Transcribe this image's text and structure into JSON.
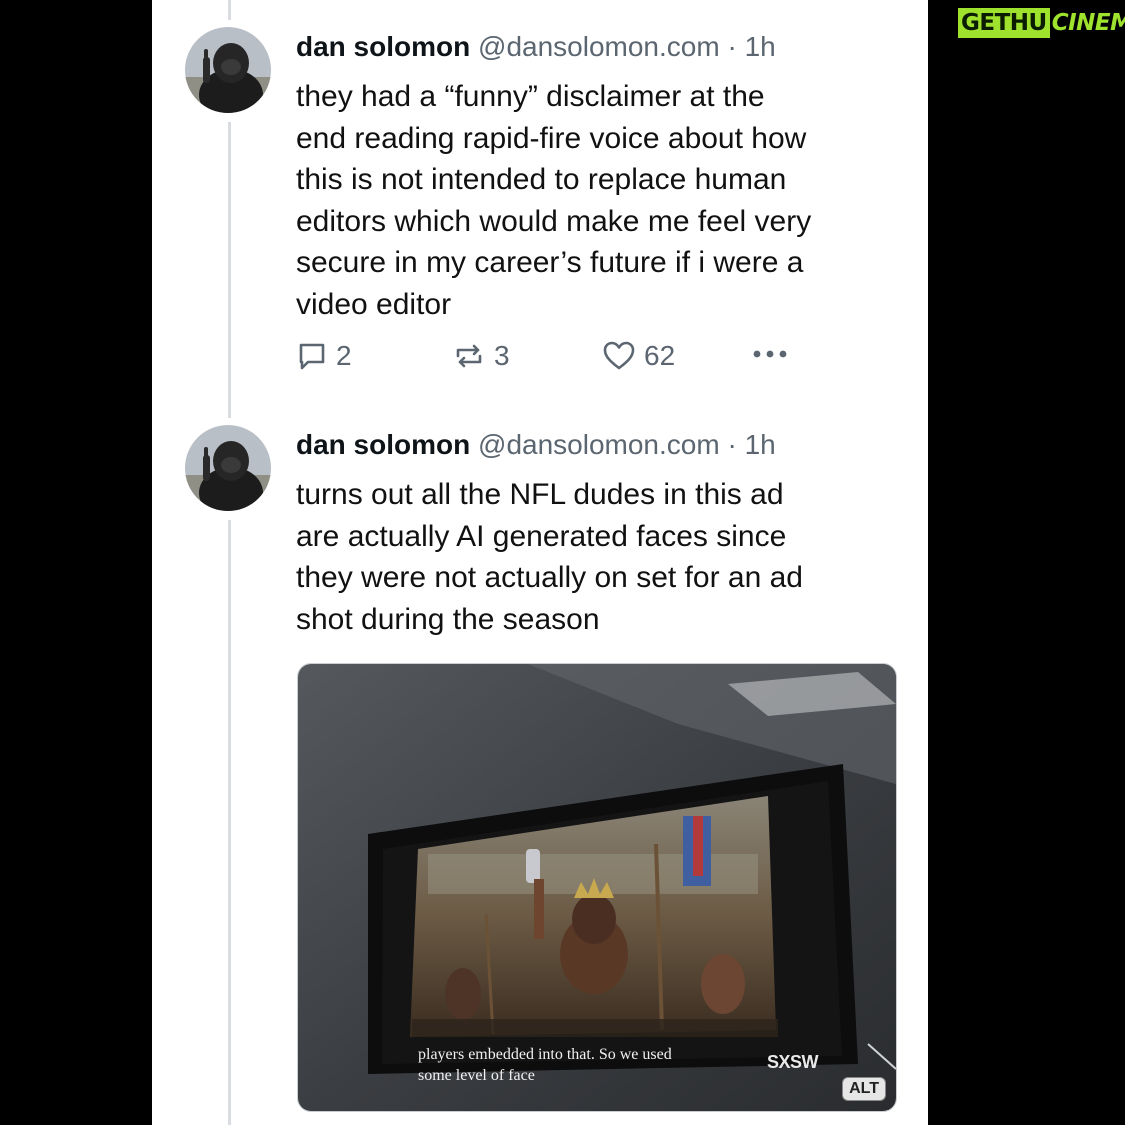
{
  "watermark": {
    "part1": "GETHU",
    "part2": "CINEMA"
  },
  "posts": [
    {
      "author": "dan solomon",
      "handle": "@dansolomon.com",
      "separator": "·",
      "time": "1h",
      "lines": [
        "they had a “funny” disclaimer at the",
        "end reading rapid-fire voice about how",
        "this is not intended to replace human",
        "editors which would make me feel very",
        "secure in my career’s future if i were a",
        "video editor"
      ],
      "stats": {
        "replies": "2",
        "reposts": "3",
        "likes": "62"
      },
      "icons": {
        "reply": "reply-icon",
        "repost": "repost-icon",
        "like": "heart-icon",
        "more": "more-options-icon"
      }
    },
    {
      "author": "dan solomon",
      "handle": "@dansolomon.com",
      "separator": "·",
      "time": "1h",
      "lines": [
        "turns out all the NFL dudes in this ad",
        "are actually AI generated faces since",
        "they were not actually on set for an ad",
        "shot during the season"
      ],
      "media": {
        "alt_badge": "ALT",
        "caption": "players embedded into that. So we used some level of face",
        "logo_text": "SXSW"
      }
    }
  ],
  "colors": {
    "thread_line": "#d9dde2",
    "muted": "#5b6670",
    "watermark_green": "#9ee22d"
  }
}
